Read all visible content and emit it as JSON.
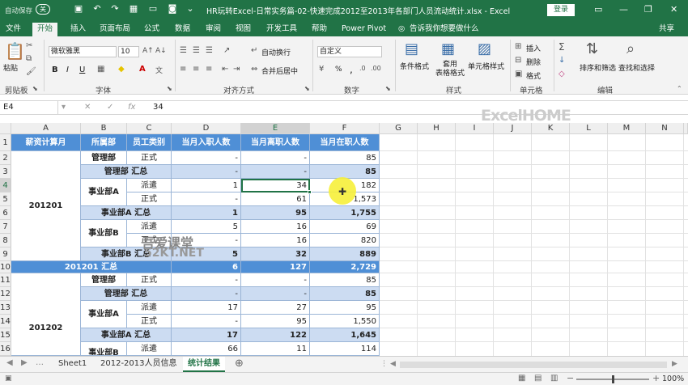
{
  "titlebar": {
    "autosave": "自动保存",
    "autosave_state": "关",
    "title": "HR玩转Excel-日常实务篇-02-快速完成2012至2013年各部门人员流动统计.xlsx  -  Excel",
    "login": "登录"
  },
  "tabs": [
    "文件",
    "开始",
    "插入",
    "页面布局",
    "公式",
    "数据",
    "审阅",
    "视图",
    "开发工具",
    "帮助",
    "Power Pivot"
  ],
  "tell_me": "告诉我你想要做什么",
  "share": "共享",
  "ribbon": {
    "paste": "粘贴",
    "clipboard": "剪贴板",
    "font_name": "微软雅黑",
    "font_size": "10",
    "font_group": "字体",
    "bold": "B",
    "italic": "I",
    "underline": "U",
    "wrap": "自动换行",
    "merge": "合并后居中",
    "align_group": "对齐方式",
    "numfmt": "自定义",
    "percent": "%",
    "comma": ",",
    "number_group": "数字",
    "cond_fmt": "条件格式",
    "table_fmt": "套用\n表格格式",
    "cell_style": "单元格样式",
    "style_group": "样式",
    "insert": "插入",
    "delete": "删除",
    "format": "格式",
    "cells_group": "单元格",
    "sort": "排序和筛选",
    "find": "查找和选择",
    "edit_group": "编辑",
    "watermark": "ExcelHOME"
  },
  "formula": {
    "namebox": "E4",
    "fx": "fx",
    "value": "34"
  },
  "columns": [
    "A",
    "B",
    "C",
    "D",
    "E",
    "F",
    "G",
    "H",
    "I",
    "J",
    "K",
    "L",
    "M",
    "N"
  ],
  "rows": [
    "1",
    "2",
    "3",
    "4",
    "5",
    "6",
    "7",
    "8",
    "9",
    "10",
    "11",
    "12",
    "13",
    "14",
    "15",
    "16"
  ],
  "headers": [
    "薪资计算月",
    "所属部",
    "员工类别",
    "当月入职人数",
    "当月离职人数",
    "当月在职人数"
  ],
  "cells": {
    "a_201201": "201201",
    "a_201202": "201202",
    "b2": "管理部",
    "b3": "管理部 汇总",
    "b4": "事业部A",
    "b6": "事业部A 汇总",
    "b7": "事业部B",
    "b9": "事业部B 汇总",
    "a10": "201201 汇总",
    "b11": "管理部",
    "b12": "管理部 汇总",
    "b13": "事业部A",
    "b15": "事业部A 汇总",
    "b16": "事业部B",
    "c2": "正式",
    "c4": "派遣",
    "c5": "正式",
    "c7": "派遣",
    "c8": "正式",
    "c11": "正式",
    "c13": "派遣",
    "c14": "正式",
    "c16": "派遣",
    "d2": "-",
    "e2": "-",
    "f2": "85",
    "d3": "-",
    "e3": "-",
    "f3": "85",
    "d4": "1",
    "e4": "34",
    "f4": "182",
    "d5": "-",
    "e5": "61",
    "f5": "1,573",
    "d6": "1",
    "e6": "95",
    "f6": "1,755",
    "d7": "5",
    "e7": "16",
    "f7": "69",
    "d8": "-",
    "e8": "16",
    "f8": "820",
    "d9": "5",
    "e9": "32",
    "f9": "889",
    "d10": "6",
    "e10": "127",
    "f10": "2,729",
    "d11": "-",
    "e11": "-",
    "f11": "85",
    "d12": "-",
    "e12": "-",
    "f12": "85",
    "d13": "17",
    "e13": "27",
    "f13": "95",
    "d14": "-",
    "e14": "95",
    "f14": "1,550",
    "d15": "17",
    "e15": "122",
    "f15": "1,645",
    "d16": "66",
    "e16": "11",
    "f16": "114"
  },
  "sheets": [
    "Sheet1",
    "2012-2013人员信息",
    "统计结果"
  ],
  "status": {
    "zoom": "100%"
  },
  "overlay": {
    "wm1": "吾爱课堂",
    "wm2": "52KT.NET"
  }
}
